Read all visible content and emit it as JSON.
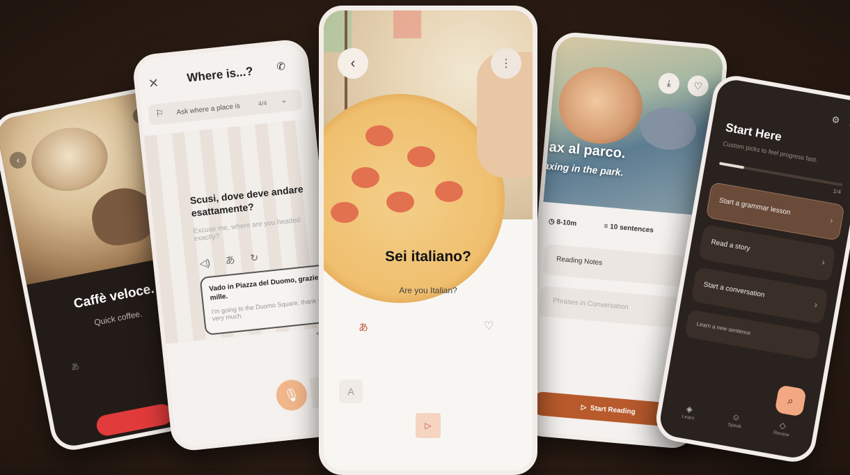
{
  "screen1": {
    "title": "Caffè veloce.",
    "subtitle": "Quick coffee."
  },
  "screen2": {
    "title": "Where is...?",
    "task_label": "Ask where a place is",
    "task_count": "4/4",
    "prompt_italian": "Scusi, dove deve andare esattamente?",
    "prompt_english": "Excuse me, where are you headed exactly?",
    "reply_italian": "Vado in Piazza del Duomo, grazie mille.",
    "reply_english": "I'm going to the Duomo Square, thank you very much."
  },
  "screen3": {
    "title": "Sei italiano?",
    "subtitle": "Are you Italian?",
    "text_size_label": "A"
  },
  "screen4": {
    "title_italian": "lax al parco.",
    "title_english": "axing in the park.",
    "duration": "8-10m",
    "sentences": "10 sentences",
    "rows": [
      {
        "label": "Reading Notes"
      },
      {
        "label": "Phrases in Conversation"
      }
    ],
    "start_button": "Start Reading"
  },
  "screen5": {
    "title": "Start Here",
    "description": "Custom picks to feel progress fast.",
    "progress_text": "1/4",
    "progress_fraction": 0.2,
    "cards": [
      {
        "label": "Start a grammar lesson",
        "selected": true
      },
      {
        "label": "Read a story",
        "selected": false
      },
      {
        "label": "Start a conversation",
        "selected": false
      },
      {
        "label": "Learn a new sentence",
        "selected": false
      }
    ],
    "nav": [
      {
        "label": "Learn"
      },
      {
        "label": "Speak"
      },
      {
        "label": "Review"
      }
    ]
  },
  "colors": {
    "accent": "#b85a2c",
    "record_red": "#e23b3b",
    "peach": "#f2a882",
    "background": "#2f1f16"
  }
}
